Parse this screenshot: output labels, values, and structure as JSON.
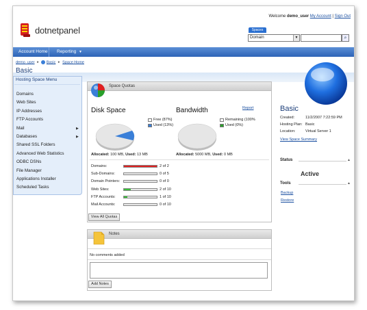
{
  "header": {
    "welcome_prefix": "Welcome",
    "username": "demo_user",
    "my_account": "My Account",
    "divider": "|",
    "sign_out": "Sign Out",
    "logo_text": "dotnetpanel",
    "spaces_tab": "Spaces",
    "spaces_select_value": "Domain",
    "search_placeholder": ""
  },
  "nav": {
    "account_home": "Account Home",
    "reporting": "Reporting"
  },
  "breadcrumb": {
    "user": "demo_user",
    "space": "Basic",
    "page": "Space Home"
  },
  "page_title": "Basic",
  "sidebar": {
    "title": "Hosting Space Menu",
    "items": [
      {
        "label": "Domains",
        "submenu": false
      },
      {
        "label": "Web Sites",
        "submenu": false
      },
      {
        "label": "IP Addresses",
        "submenu": false
      },
      {
        "label": "FTP Accounts",
        "submenu": false
      },
      {
        "label": "Mail",
        "submenu": true
      },
      {
        "label": "Databases",
        "submenu": true
      },
      {
        "label": "Shared SSL Folders",
        "submenu": false
      },
      {
        "label": "Advanced Web Statistics",
        "submenu": false
      },
      {
        "label": "ODBC DSNs",
        "submenu": false
      },
      {
        "label": "File Manager",
        "submenu": false
      },
      {
        "label": "Applications Installer",
        "submenu": false
      },
      {
        "label": "Scheduled Tasks",
        "submenu": false
      }
    ]
  },
  "quotas": {
    "header": "Space Quotas",
    "disk": {
      "title": "Disk Space",
      "free_label": "Free (87%)",
      "used_label": "Used (13%)",
      "used_fraction": 0.13,
      "allocated_label": "Allocated:",
      "allocated_value": "100 MB,",
      "used_label2": "Used:",
      "used_value": "13 MB"
    },
    "bandwidth": {
      "title": "Bandwidth",
      "report_link": "Report",
      "remaining_label": "Remaining (100%",
      "used_label": "Used (0%)",
      "allocated_label": "Allocated:",
      "allocated_value": "5000 MB,",
      "used_label2": "Used:",
      "used_value": "0 MB"
    },
    "rows": [
      {
        "label": "Domains:",
        "value": "2 of 2",
        "fraction": 1.0,
        "color": "#e02020"
      },
      {
        "label": "Sub-Domains:",
        "value": "0 of 5",
        "fraction": 0.0,
        "color": "#3bbf3b"
      },
      {
        "label": "Domain Pointers:",
        "value": "0 of 0",
        "fraction": 0.0,
        "color": "#3bbf3b"
      },
      {
        "label": "Web Sites:",
        "value": "2 of 10",
        "fraction": 0.2,
        "color": "#3bbf3b"
      },
      {
        "label": "FTP Accounts:",
        "value": "1 of 10",
        "fraction": 0.1,
        "color": "#3bbf3b"
      },
      {
        "label": "Mail Accounts:",
        "value": "0 of 10",
        "fraction": 0.0,
        "color": "#3bbf3b"
      }
    ],
    "view_all_button": "View All Quotas"
  },
  "notes": {
    "header": "Notes",
    "empty_text": "No comments added",
    "add_button": "Add Notes"
  },
  "space_info": {
    "name": "Basic",
    "created_label": "Created:",
    "created_value": "11/2/2007 7:22:59 PM",
    "plan_label": "Hosting Plan:",
    "plan_value": "Basic",
    "location_label": "Location:",
    "location_value": "Virtual Server 1",
    "summary_link": "View Space Summary"
  },
  "status_section": {
    "title": "Status",
    "value": "Active"
  },
  "tools_section": {
    "title": "Tools",
    "links": [
      "Backup",
      "Restore"
    ]
  },
  "colors": {
    "nav_blue": "#2d63b6",
    "title_blue": "#1d3f7a",
    "used_blue": "#3a7fd8",
    "bw_used_green": "#2aa02a"
  }
}
